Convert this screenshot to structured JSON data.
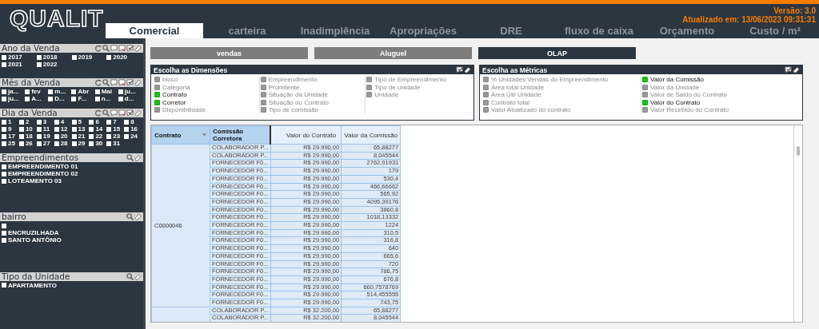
{
  "header": {
    "logo": "QUALIT",
    "version": "Versão: 3.0",
    "updated": "Atualizado em: 13/06/2023 09:31:31",
    "tabs": [
      {
        "label": "Comercial",
        "selected": true
      },
      {
        "label": "carteira",
        "selected": false
      },
      {
        "label": "Inadimplência",
        "selected": false
      },
      {
        "label": "Apropriações",
        "selected": false
      },
      {
        "label": "DRE",
        "selected": false
      },
      {
        "label": "fluxo de caixa",
        "selected": false
      },
      {
        "label": "Orçamento",
        "selected": false
      },
      {
        "label": "Custo / m²",
        "selected": false
      }
    ]
  },
  "filters": [
    {
      "title": "Ano da Venda",
      "kind": "year",
      "items": [
        {
          "label": "2017",
          "checked": false
        },
        {
          "label": "2018",
          "checked": false
        },
        {
          "label": "2019",
          "checked": false
        },
        {
          "label": "2020",
          "checked": false
        },
        {
          "label": "2021",
          "checked": false
        },
        {
          "label": "2022",
          "checked": false
        }
      ]
    },
    {
      "title": "Mês da Venda",
      "kind": "month",
      "items": [
        {
          "label": "ja...",
          "checked": false
        },
        {
          "label": "fev",
          "checked": false
        },
        {
          "label": "m...",
          "checked": false
        },
        {
          "label": "Abr",
          "checked": false
        },
        {
          "label": "Mai",
          "checked": false
        },
        {
          "label": "ju...",
          "checked": false
        },
        {
          "label": "ju...",
          "checked": false
        },
        {
          "label": "A...",
          "checked": false
        },
        {
          "label": "D...",
          "checked": false
        },
        {
          "label": "F...",
          "checked": false
        },
        {
          "label": "n...",
          "checked": false
        },
        {
          "label": "d...",
          "checked": false
        }
      ]
    },
    {
      "title": "Dia da Venda",
      "kind": "day",
      "items": [
        {
          "label": "1",
          "checked": false
        },
        {
          "label": "2",
          "checked": false
        },
        {
          "label": "3",
          "checked": false
        },
        {
          "label": "4",
          "checked": false
        },
        {
          "label": "5",
          "checked": false
        },
        {
          "label": "6",
          "checked": false
        },
        {
          "label": "7",
          "checked": false
        },
        {
          "label": "8",
          "checked": false
        },
        {
          "label": "9",
          "checked": false
        },
        {
          "label": "10",
          "checked": false
        },
        {
          "label": "11",
          "checked": false
        },
        {
          "label": "12",
          "checked": false
        },
        {
          "label": "13",
          "checked": false
        },
        {
          "label": "14",
          "checked": false
        },
        {
          "label": "15",
          "checked": false
        },
        {
          "label": "16",
          "checked": false
        },
        {
          "label": "17",
          "checked": false
        },
        {
          "label": "18",
          "checked": false
        },
        {
          "label": "19",
          "checked": false
        },
        {
          "label": "20",
          "checked": false
        },
        {
          "label": "21",
          "checked": false
        },
        {
          "label": "22",
          "checked": false
        },
        {
          "label": "23",
          "checked": false
        },
        {
          "label": "24",
          "checked": false
        },
        {
          "label": "25",
          "checked": false
        },
        {
          "label": "26",
          "checked": false
        },
        {
          "label": "27",
          "checked": false
        },
        {
          "label": "28",
          "checked": false
        },
        {
          "label": "29",
          "checked": false
        },
        {
          "label": "30",
          "checked": false
        },
        {
          "label": "31",
          "checked": false
        }
      ]
    },
    {
      "title": "Empreendimentos",
      "kind": "list",
      "items": [
        {
          "label": "EMPREENDIMENTO 01",
          "checked": false
        },
        {
          "label": "EMPREENDIMENTO 02",
          "checked": false
        },
        {
          "label": "LOTEAMENTO 03",
          "checked": false
        }
      ]
    },
    {
      "title": "bairro",
      "kind": "list",
      "items": [
        {
          "checked": false
        },
        {
          "label": "ENCRUZILHADA",
          "checked": false
        },
        {
          "label": "SANTO ANTÔNIO",
          "checked": false
        }
      ]
    },
    {
      "title": "Tipo da Unidade",
      "kind": "list",
      "items": [
        {
          "label": "APARTAMENTO",
          "checked": false
        }
      ]
    }
  ],
  "views": [
    {
      "label": "vendas",
      "selected": false
    },
    {
      "label": "Aluguel",
      "selected": false
    },
    {
      "label": "OLAP",
      "selected": true
    }
  ],
  "choosers": [
    {
      "title": "Escolha as Dimensões",
      "columns": [
        [
          {
            "label": "bloco",
            "checked": false
          },
          {
            "label": "Categoria",
            "checked": false
          },
          {
            "label": "Contrato",
            "checked": true
          },
          {
            "label": "Corretor",
            "checked": true
          },
          {
            "label": "Disponibilidade",
            "checked": false
          }
        ],
        [
          {
            "label": "Empreendimento",
            "checked": false
          },
          {
            "label": "Promitente",
            "checked": false
          },
          {
            "label": "Situação da Unidade",
            "checked": false
          },
          {
            "label": "Situação do Contrato",
            "checked": false
          },
          {
            "label": "Tipo de comissão",
            "checked": false
          }
        ],
        [
          {
            "label": "Tipo de Empreendimento",
            "checked": false
          },
          {
            "label": "Tipo de unidade",
            "checked": false
          },
          {
            "label": "Unidade",
            "checked": false
          }
        ]
      ]
    },
    {
      "title": "Escolha as Métricas",
      "columns": [
        [
          {
            "label": "% Unidades Vendas do Empreendimento",
            "checked": false
          },
          {
            "label": "Área total Unidade",
            "checked": false
          },
          {
            "label": "Área Útil Unidade",
            "checked": false
          },
          {
            "label": "Contrato total",
            "checked": false
          },
          {
            "label": "Valor Atualizado do contrato",
            "checked": false
          }
        ],
        [
          {
            "label": "Valor da Comissão",
            "checked": true
          },
          {
            "label": "Valor da Unidade",
            "checked": false
          },
          {
            "label": "Valor de Saldo do Contrato",
            "checked": false
          },
          {
            "label": "Valor do Contrato",
            "checked": true
          },
          {
            "label": "Valor Recebido do Contrato",
            "checked": false
          }
        ]
      ]
    }
  ],
  "table": {
    "columns": [
      "Contrato",
      "Comissão Corretora",
      "Valor do Contrato",
      "Valor da Comissão"
    ],
    "groups": [
      {
        "contrato": "C0000046",
        "rows": [
          [
            "COLABORADOR P...",
            "R$ 29.990,00",
            "65,88277"
          ],
          [
            "COLABORADOR P...",
            "R$ 29.990,00",
            "8,045544"
          ],
          [
            "FORNECEDOR F0...",
            "R$ 29.990,00",
            "2762,91931"
          ],
          [
            "FORNECEDOR F0...",
            "R$ 29.990,00",
            "179"
          ],
          [
            "FORNECEDOR F0...",
            "R$ 29.990,00",
            "530,4"
          ],
          [
            "FORNECEDOR F0...",
            "R$ 29.990,00",
            "466,66662"
          ],
          [
            "FORNECEDOR F0...",
            "R$ 29.990,00",
            "565,92"
          ],
          [
            "FORNECEDOR F0...",
            "R$ 29.990,00",
            "4095,39176"
          ],
          [
            "FORNECEDOR F0...",
            "R$ 29.990,00",
            "3860,8"
          ],
          [
            "FORNECEDOR F0...",
            "R$ 29.990,00",
            "1018,13332"
          ],
          [
            "FORNECEDOR F0...",
            "R$ 29.990,00",
            "1224"
          ],
          [
            "FORNECEDOR F0...",
            "R$ 29.990,00",
            "310,5"
          ],
          [
            "FORNECEDOR F0...",
            "R$ 29.990,00",
            "316,8"
          ],
          [
            "FORNECEDOR F0...",
            "R$ 29.990,00",
            "640"
          ],
          [
            "FORNECEDOR F0...",
            "R$ 29.990,00",
            "665,6"
          ],
          [
            "FORNECEDOR F0...",
            "R$ 29.990,00",
            "720"
          ],
          [
            "FORNECEDOR F0...",
            "R$ 29.990,00",
            "786,75"
          ],
          [
            "FORNECEDOR F0...",
            "R$ 29.990,00",
            "676,8"
          ],
          [
            "FORNECEDOR F0...",
            "R$ 29.990,00",
            "660,7578769"
          ],
          [
            "FORNECEDOR F0...",
            "R$ 29.990,00",
            "514,455555"
          ],
          [
            "FORNECEDOR F0...",
            "R$ 29.990,00",
            "743,75"
          ]
        ]
      },
      {
        "rows": [
          [
            "COLABORADOR P...",
            "R$ 32.200,00",
            "65,88277"
          ],
          [
            "COLABORADOR P...",
            "R$ 32.200,00",
            "8,045544"
          ]
        ]
      }
    ]
  }
}
